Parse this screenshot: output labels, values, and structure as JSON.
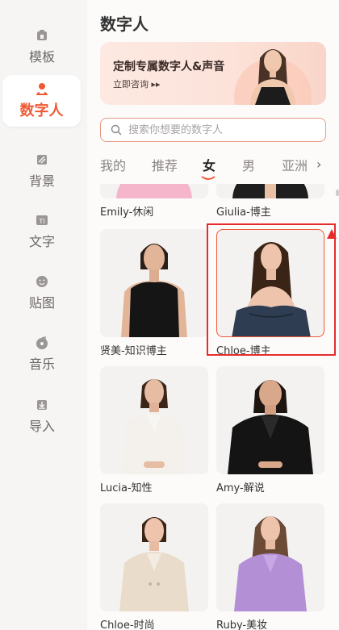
{
  "sidebar": {
    "items": [
      {
        "label": "模板",
        "icon": "template-icon"
      },
      {
        "label": "数字人",
        "icon": "avatar-person-icon",
        "active": true
      },
      {
        "label": "背景",
        "icon": "background-icon"
      },
      {
        "label": "文字",
        "icon": "text-icon"
      },
      {
        "label": "贴图",
        "icon": "sticker-icon"
      },
      {
        "label": "音乐",
        "icon": "music-icon"
      },
      {
        "label": "导入",
        "icon": "import-icon"
      }
    ]
  },
  "main": {
    "title": "数字人",
    "banner": {
      "title": "定制专属数字人&声音",
      "link": "立即咨询 ▸▸"
    },
    "search": {
      "placeholder": "搜索你想要的数字人"
    },
    "tabs": [
      {
        "label": "我的"
      },
      {
        "label": "推荐"
      },
      {
        "label": "女",
        "active": true
      },
      {
        "label": "男"
      },
      {
        "label": "亚洲"
      }
    ],
    "cards": [
      {
        "label": "Emily-休闲"
      },
      {
        "label": "Giulia-博主"
      },
      {
        "label": "贤美-知识博主"
      },
      {
        "label": "Chloe-博主",
        "selected": true
      },
      {
        "label": "Lucia-知性"
      },
      {
        "label": "Amy-解说"
      },
      {
        "label": "Chloe-时尚"
      },
      {
        "label": "Ruby-美妆"
      }
    ]
  },
  "colors": {
    "accent": "#ee5a36",
    "highlight": "#e52c2c"
  }
}
